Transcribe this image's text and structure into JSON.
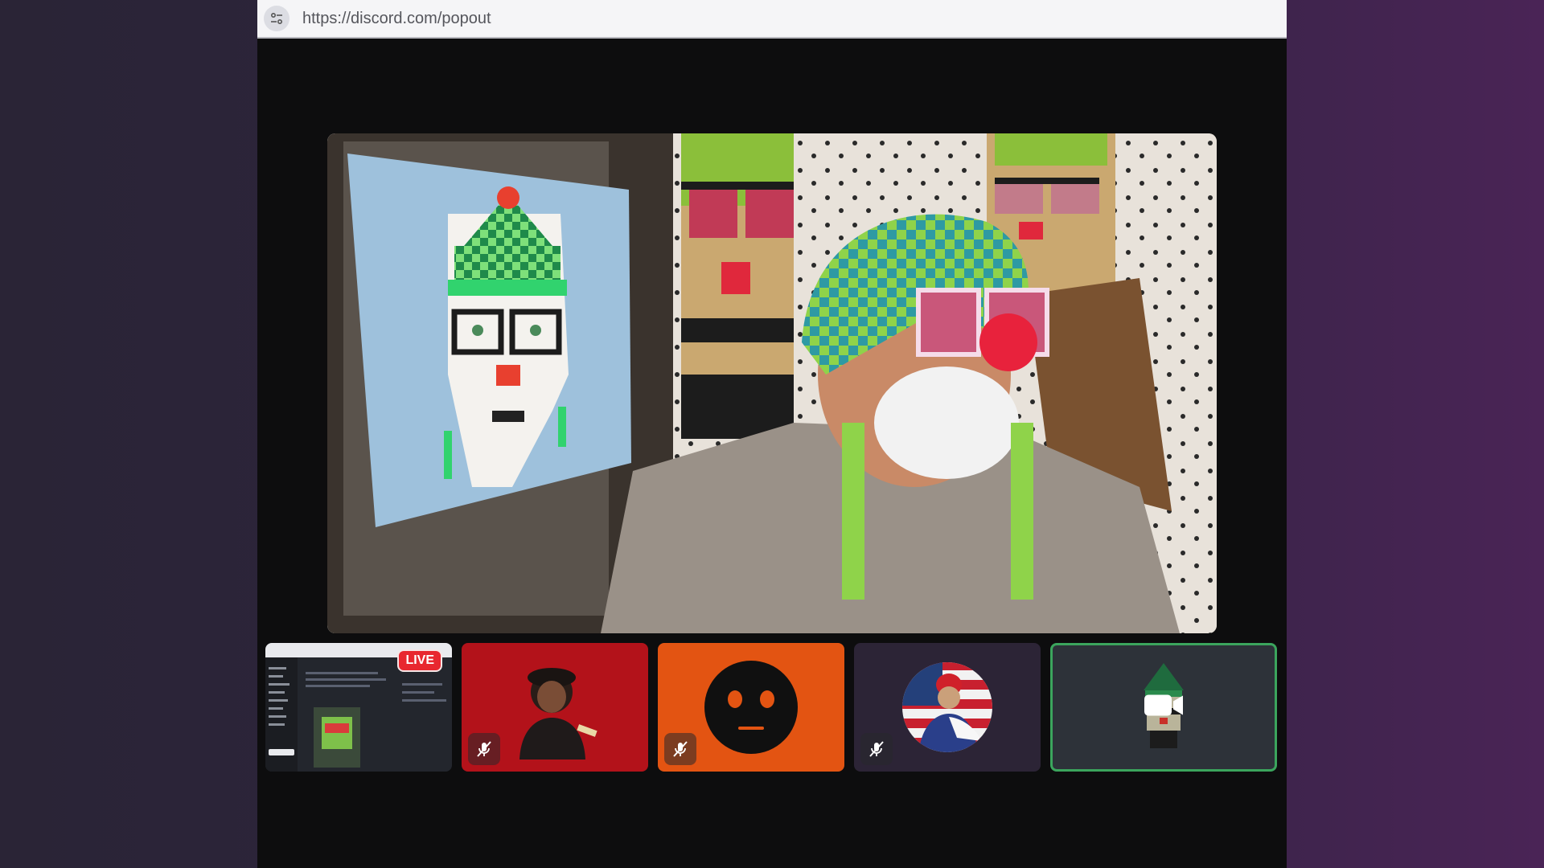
{
  "browser": {
    "url": "https://discord.com/popout",
    "site_icon": "page-settings-icon"
  },
  "main_video": {
    "description_icon": "webcam-stream"
  },
  "tiles": [
    {
      "type": "screen-share",
      "badge": "LIVE"
    },
    {
      "type": "user",
      "background": "#b3121a",
      "muted": true,
      "icon": "mic-muted-icon"
    },
    {
      "type": "user",
      "background": "#e35412",
      "muted": true,
      "icon": "mic-muted-icon"
    },
    {
      "type": "user",
      "background": "#2c2436",
      "muted": true,
      "icon": "mic-muted-icon"
    },
    {
      "type": "user-active",
      "background": "#2d3239",
      "speaking": true,
      "icon": "video-camera-icon",
      "border_color": "#3ba55d"
    }
  ]
}
